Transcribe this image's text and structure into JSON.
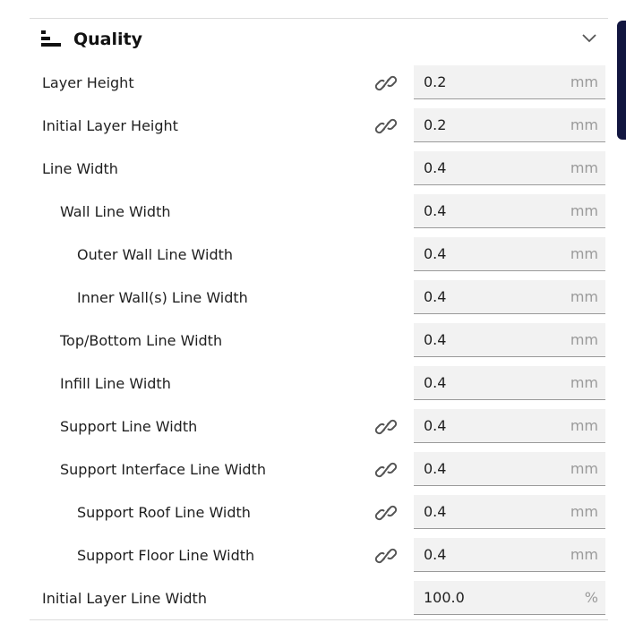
{
  "section": {
    "title": "Quality",
    "icon": "quality-bars-icon",
    "collapse_icon": "chevron-down-icon"
  },
  "rows": [
    {
      "label": "Layer Height",
      "indent": 0,
      "linked": true,
      "value": "0.2",
      "unit": "mm"
    },
    {
      "label": "Initial Layer Height",
      "indent": 0,
      "linked": true,
      "value": "0.2",
      "unit": "mm"
    },
    {
      "label": "Line Width",
      "indent": 0,
      "linked": false,
      "value": "0.4",
      "unit": "mm"
    },
    {
      "label": "Wall Line Width",
      "indent": 1,
      "linked": false,
      "value": "0.4",
      "unit": "mm"
    },
    {
      "label": "Outer Wall Line Width",
      "indent": 2,
      "linked": false,
      "value": "0.4",
      "unit": "mm"
    },
    {
      "label": "Inner Wall(s) Line Width",
      "indent": 2,
      "linked": false,
      "value": "0.4",
      "unit": "mm"
    },
    {
      "label": "Top/Bottom Line Width",
      "indent": 1,
      "linked": false,
      "value": "0.4",
      "unit": "mm"
    },
    {
      "label": "Infill Line Width",
      "indent": 1,
      "linked": false,
      "value": "0.4",
      "unit": "mm"
    },
    {
      "label": "Support Line Width",
      "indent": 1,
      "linked": true,
      "value": "0.4",
      "unit": "mm"
    },
    {
      "label": "Support Interface Line Width",
      "indent": 1,
      "linked": true,
      "value": "0.4",
      "unit": "mm"
    },
    {
      "label": "Support Roof Line Width",
      "indent": 2,
      "linked": true,
      "value": "0.4",
      "unit": "mm"
    },
    {
      "label": "Support Floor Line Width",
      "indent": 2,
      "linked": true,
      "value": "0.4",
      "unit": "mm"
    },
    {
      "label": "Initial Layer Line Width",
      "indent": 0,
      "linked": false,
      "value": "100.0",
      "unit": "%"
    }
  ]
}
